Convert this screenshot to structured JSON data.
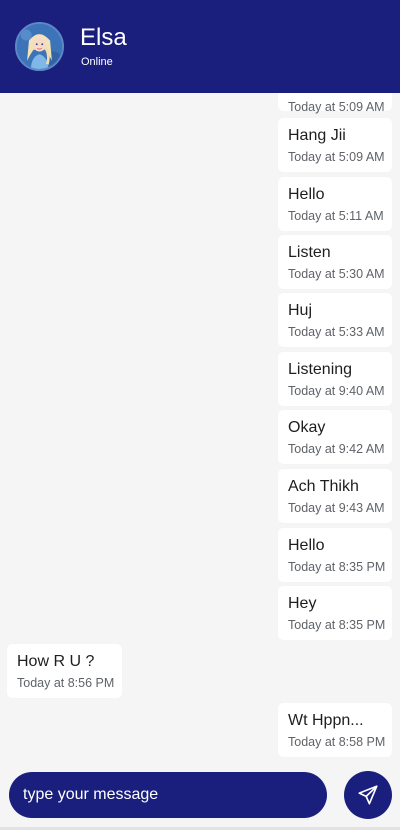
{
  "header": {
    "name": "Elsa",
    "status": "Online",
    "avatar_icon": "elsa-avatar"
  },
  "messages": [
    {
      "text": "",
      "time": "Today at 5:09 AM",
      "direction": "sent"
    },
    {
      "text": "Hang Jii",
      "time": "Today at 5:09 AM",
      "direction": "sent"
    },
    {
      "text": "Hello",
      "time": "Today at 5:11 AM",
      "direction": "sent"
    },
    {
      "text": "Listen",
      "time": "Today at 5:30 AM",
      "direction": "sent"
    },
    {
      "text": "Huj",
      "time": "Today at 5:33 AM",
      "direction": "sent"
    },
    {
      "text": "Listening",
      "time": "Today at 9:40 AM",
      "direction": "sent"
    },
    {
      "text": "Okay",
      "time": "Today at 9:42 AM",
      "direction": "sent"
    },
    {
      "text": "Ach Thikh",
      "time": "Today at 9:43 AM",
      "direction": "sent"
    },
    {
      "text": "Hello",
      "time": "Today at 8:35 PM",
      "direction": "sent"
    },
    {
      "text": "Hey",
      "time": "Today at 8:35 PM",
      "direction": "sent"
    },
    {
      "text": "How R U ?",
      "time": "Today at 8:56 PM",
      "direction": "received"
    },
    {
      "text": "Wt Hppn...",
      "time": "Today at 8:58 PM",
      "direction": "sent"
    }
  ],
  "composer": {
    "placeholder": "type your message",
    "send_icon": "send-icon"
  },
  "colors": {
    "primary": "#1a1f7e",
    "background": "#f5f5f5",
    "bubble": "#ffffff"
  }
}
